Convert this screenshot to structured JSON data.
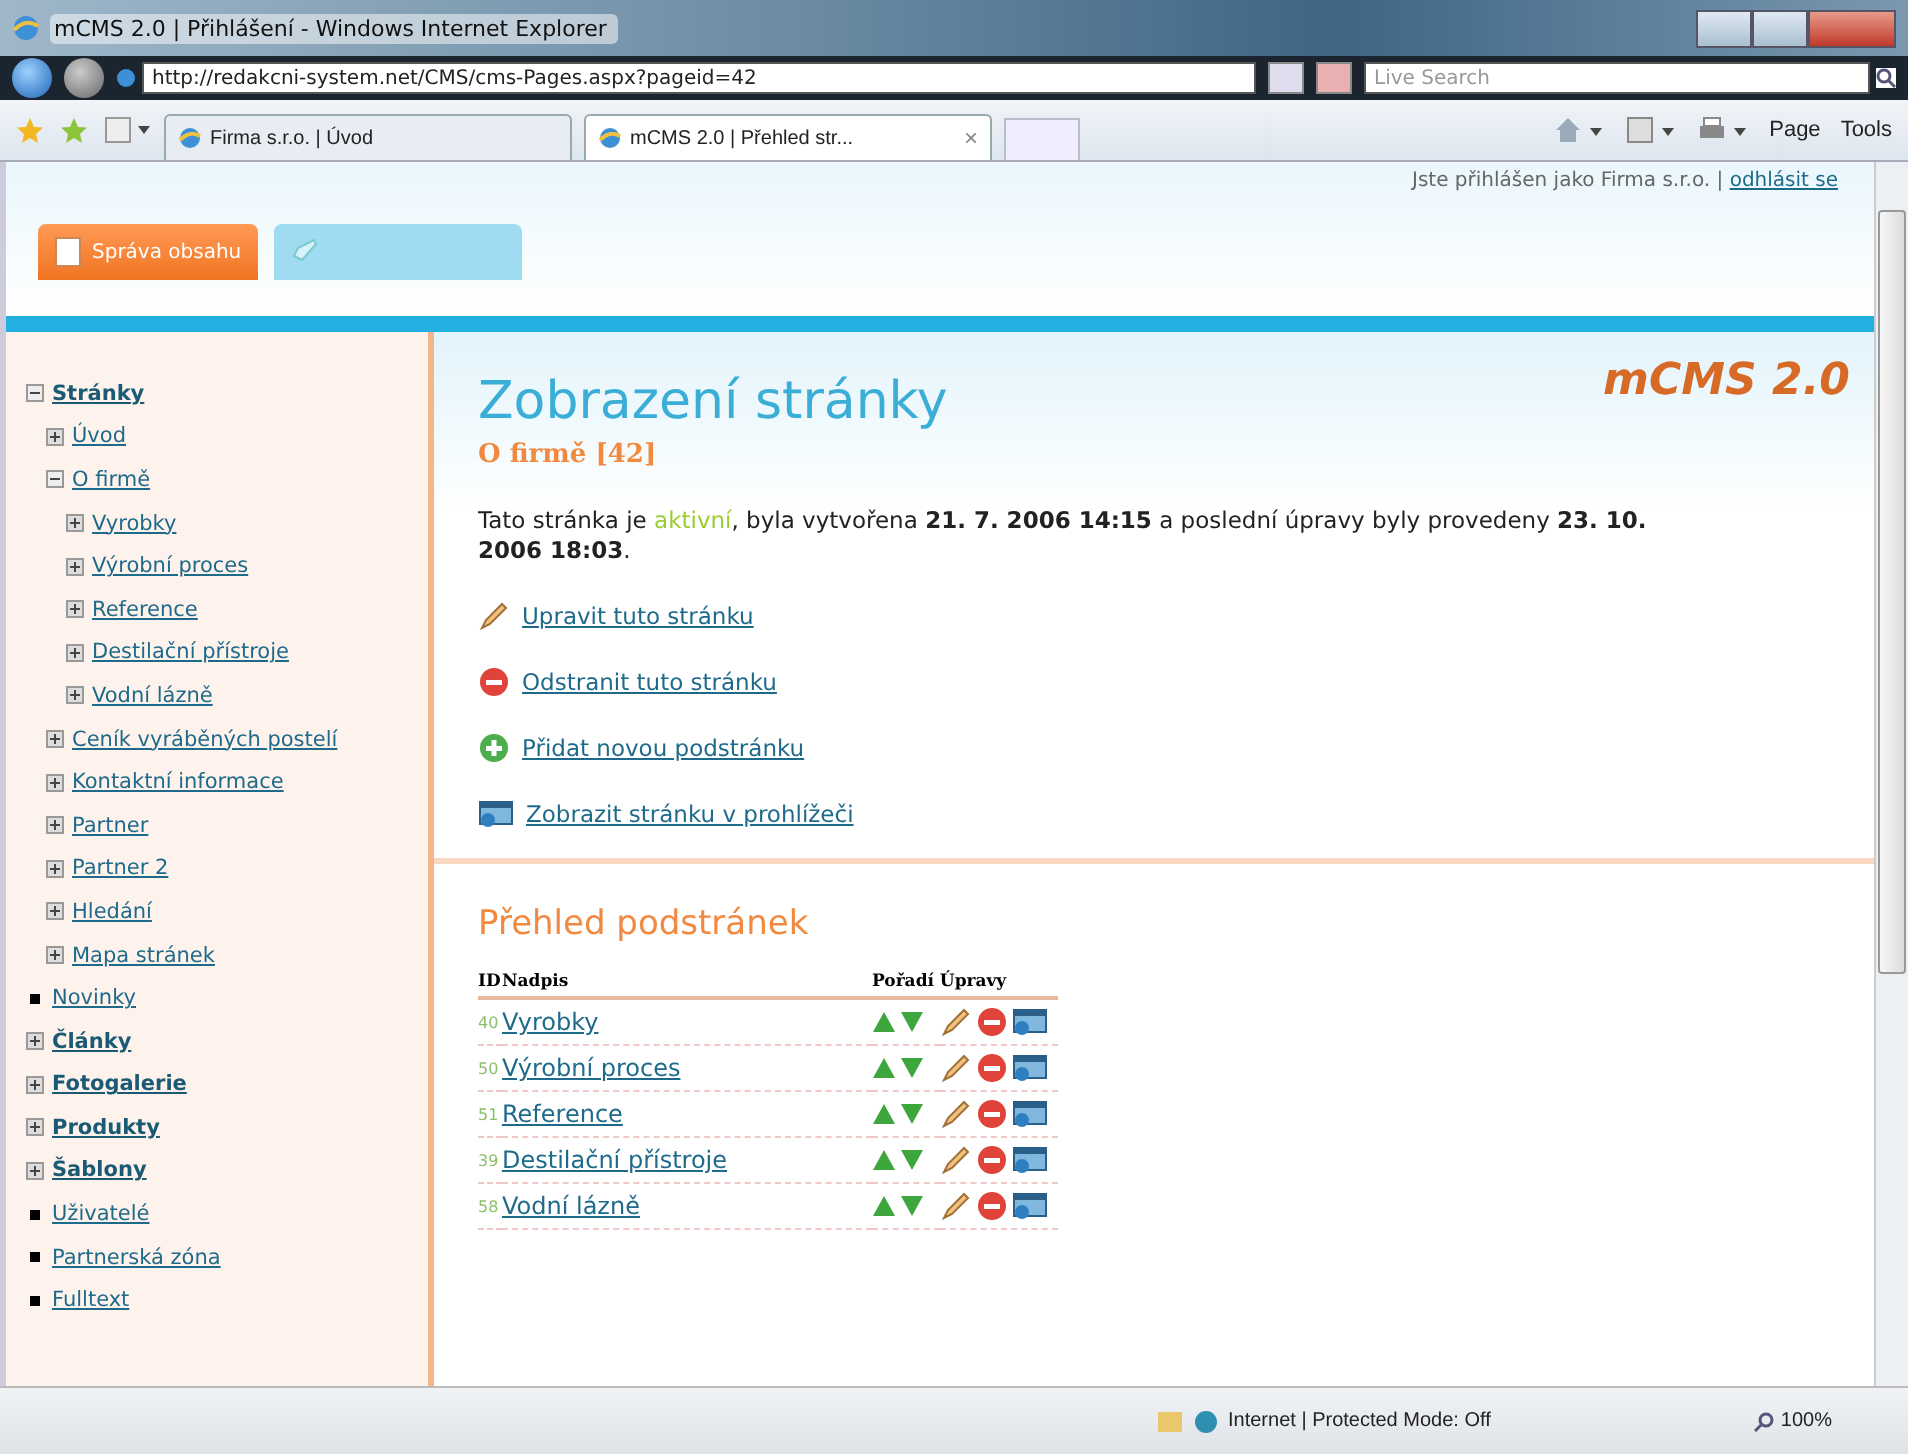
{
  "window": {
    "title": "mCMS 2.0 | Přihlášení - Windows Internet Explorer"
  },
  "address_bar": {
    "url": "http://redakcni-system.net/CMS/cms-Pages.aspx?pageid=42",
    "search_placeholder": "Live Search"
  },
  "browser_tabs": [
    {
      "label": "Firma s.r.o. | Úvod",
      "selected": false
    },
    {
      "label": "mCMS 2.0 | Přehled str...",
      "selected": true,
      "close": "×"
    }
  ],
  "command_bar": [
    "Page",
    "Tools"
  ],
  "page": {
    "login_text": "Jste přihlášen jako Firma s.r.o. |",
    "logout_link": "odhlásit se",
    "logo": "mCMS 2.0",
    "app_tabs": [
      {
        "label": "Správa obsahu",
        "selected": true
      },
      {
        "selected": false
      }
    ],
    "sidebar": [
      {
        "label": "Stránky",
        "kind": "node",
        "expanded": true,
        "children": [
          {
            "label": "Úvod",
            "kind": "node",
            "expanded": false
          },
          {
            "label": "O firmě",
            "kind": "node",
            "expanded": true,
            "children": [
              {
                "label": "Vyrobky",
                "kind": "node",
                "expanded": false
              },
              {
                "label": "Výrobní proces",
                "kind": "node",
                "expanded": false
              },
              {
                "label": "Reference",
                "kind": "node",
                "expanded": false
              },
              {
                "label": "Destilační přístroje",
                "kind": "node",
                "expanded": false
              },
              {
                "label": "Vodní lázně",
                "kind": "node",
                "expanded": false
              }
            ]
          },
          {
            "label": "Ceník vyráběných postelí",
            "kind": "node",
            "expanded": false
          },
          {
            "label": "Kontaktní informace",
            "kind": "node",
            "expanded": false
          },
          {
            "label": "Partner",
            "kind": "node",
            "expanded": false
          },
          {
            "label": "Partner 2",
            "kind": "node",
            "expanded": false
          },
          {
            "label": "Hledání",
            "kind": "node",
            "expanded": false
          },
          {
            "label": "Mapa stránek",
            "kind": "node",
            "expanded": false
          }
        ]
      },
      {
        "label": "Novinky",
        "kind": "leaf"
      },
      {
        "label": "Články",
        "kind": "node",
        "expanded": false
      },
      {
        "label": "Fotogalerie",
        "kind": "node",
        "expanded": false
      },
      {
        "label": "Produkty",
        "kind": "node",
        "expanded": false
      },
      {
        "label": "Šablony",
        "kind": "node",
        "expanded": false
      },
      {
        "label": "Uživatelé",
        "kind": "leaf"
      },
      {
        "label": "Partnerská zóna",
        "kind": "leaf"
      },
      {
        "label": "Fulltext",
        "kind": "leaf"
      }
    ],
    "heading": "Zobrazení stránky",
    "subheading": "O firmě [42]",
    "info": [
      {
        "text": "Tato stránka je ",
        "kind": "plain"
      },
      {
        "text": "aktivní",
        "kind": "status"
      },
      {
        "text": ", byla vytvořena ",
        "kind": "plain"
      },
      {
        "text": "21. 7. 2006 14:15",
        "kind": "bold"
      },
      {
        "text": " a poslední úpravy byly provedeny ",
        "kind": "plain"
      },
      {
        "text": "23. 10. 2006 18:03",
        "kind": "bold"
      },
      {
        "text": ".",
        "kind": "plain"
      }
    ],
    "actions": [
      {
        "label": "Upravit tuto stránku",
        "kind": "edit"
      },
      {
        "label": "Odstranit tuto stránku",
        "kind": "delete"
      },
      {
        "label": "Přidat novou podstránku",
        "kind": "add"
      },
      {
        "label": "Zobrazit stránku v prohlížeči",
        "kind": "view"
      }
    ],
    "subpages_title": "Přehled podstránek",
    "table": {
      "columns": [
        "ID",
        "Nadpis",
        "Pořadí",
        "Úpravy"
      ],
      "rows": [
        {
          "id": "40",
          "title": "Vyrobky"
        },
        {
          "id": "50",
          "title": "Výrobní proces"
        },
        {
          "id": "51",
          "title": "Reference"
        },
        {
          "id": "39",
          "title": "Destilační přístroje"
        },
        {
          "id": "58",
          "title": "Vodní lázně"
        }
      ]
    }
  },
  "status_bar": {
    "zone": "Internet | Protected Mode: Off",
    "zoom": "100%"
  }
}
